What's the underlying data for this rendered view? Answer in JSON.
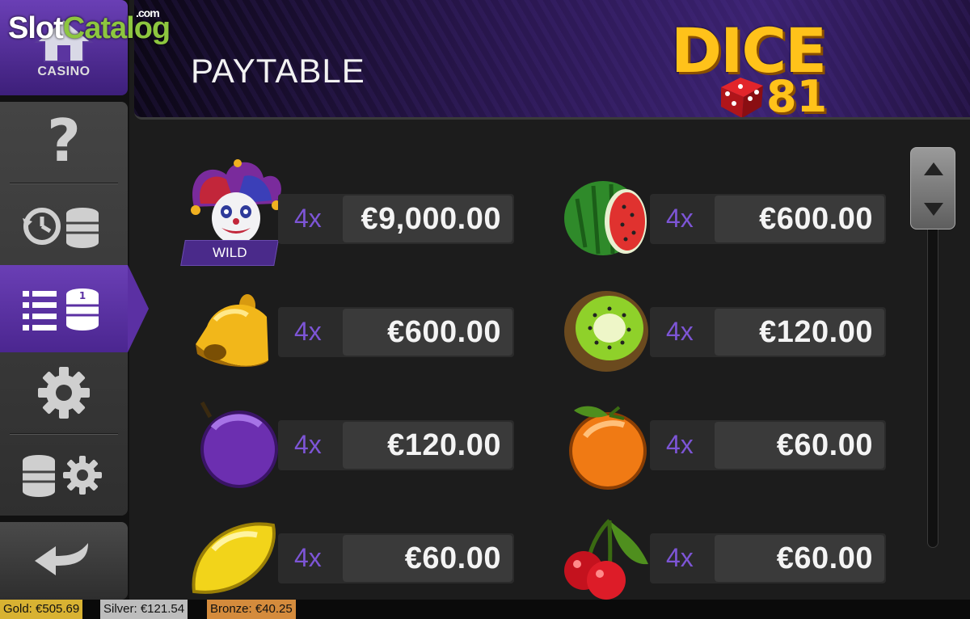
{
  "watermark": {
    "brand_a": "Slot",
    "brand_b": "Catalog",
    "suffix": ".com"
  },
  "sidebar": {
    "casino_label": "CASINO",
    "icons": [
      "home-icon",
      "help-icon",
      "history-icon",
      "paytable-icon",
      "settings-icon",
      "bet-settings-icon",
      "back-icon"
    ],
    "active": "paytable"
  },
  "header": {
    "title": "PAYTABLE",
    "logo_word": "DICE",
    "logo_number": "81"
  },
  "paytable": {
    "left": [
      {
        "symbol": "joker",
        "badge": "WILD",
        "count": "4x",
        "value": "€9,000.00"
      },
      {
        "symbol": "bell",
        "count": "4x",
        "value": "€600.00"
      },
      {
        "symbol": "plum",
        "count": "4x",
        "value": "€120.00"
      },
      {
        "symbol": "lemon",
        "count": "4x",
        "value": "€60.00"
      }
    ],
    "right": [
      {
        "symbol": "watermelon",
        "count": "4x",
        "value": "€600.00"
      },
      {
        "symbol": "kiwi",
        "count": "4x",
        "value": "€120.00"
      },
      {
        "symbol": "orange",
        "count": "4x",
        "value": "€60.00"
      },
      {
        "symbol": "cherry",
        "count": "4x",
        "value": "€60.00"
      }
    ]
  },
  "jackpots": {
    "gold": "Gold: €505.69",
    "silver": "Silver: €121.54",
    "bronze": "Bronze: €40.25"
  },
  "colors": {
    "accent": "#6a3fb5",
    "count_text": "#7d55d6",
    "logo_gold": "#ffc21a",
    "gold": "#d8b232",
    "silver": "#bdbdbd",
    "bronze": "#d48b3c"
  }
}
